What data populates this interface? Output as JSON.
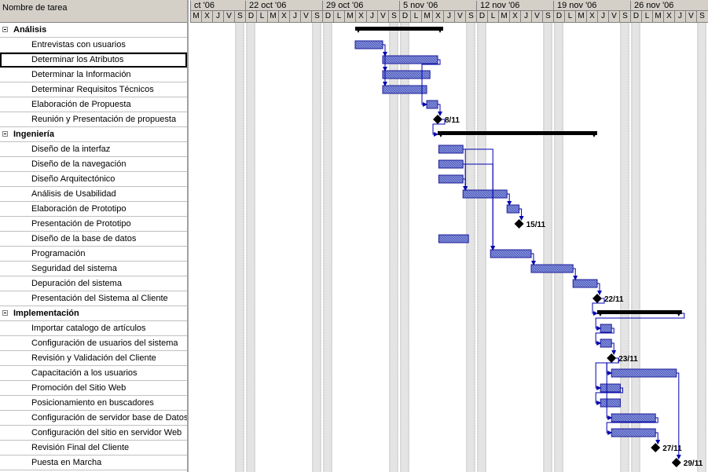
{
  "header": {
    "task_name_column": "Nombre de tarea"
  },
  "timescale": {
    "weeks": [
      {
        "label": "ct '06",
        "days": 5
      },
      {
        "label": "22 oct '06",
        "days": 7
      },
      {
        "label": "29 oct '06",
        "days": 7
      },
      {
        "label": "5 nov '06",
        "days": 7
      },
      {
        "label": "12 nov '06",
        "days": 7
      },
      {
        "label": "19 nov '06",
        "days": 7
      },
      {
        "label": "26 nov '06",
        "days": 7
      }
    ],
    "day_letters": [
      "M",
      "X",
      "J",
      "V",
      "S",
      "D",
      "L",
      "M",
      "X",
      "J",
      "V",
      "S",
      "D",
      "L",
      "M",
      "X",
      "J",
      "V",
      "S",
      "D",
      "L",
      "M",
      "X",
      "J",
      "V",
      "S",
      "D",
      "L",
      "M",
      "X",
      "J",
      "V",
      "S",
      "D",
      "L",
      "M",
      "X",
      "J",
      "V",
      "S",
      "D",
      "L",
      "M",
      "X",
      "J",
      "V",
      "S"
    ]
  },
  "tasks": [
    {
      "name": "Análisis",
      "type": "summary",
      "start": 15,
      "end": 23
    },
    {
      "name": "Entrevistas con usuarios",
      "type": "task",
      "start": 15,
      "end": 17.5
    },
    {
      "name": "Determinar los Atributos",
      "type": "task",
      "start": 17.5,
      "end": 22.5,
      "selected": true
    },
    {
      "name": "Determinar la Información",
      "type": "task",
      "start": 17.5,
      "end": 21.8
    },
    {
      "name": "Determinar Requisitos Técnicos",
      "type": "task",
      "start": 17.5,
      "end": 21.5
    },
    {
      "name": "Elaboración de Propuesta",
      "type": "task",
      "start": 21.5,
      "end": 22.5
    },
    {
      "name": "Reunión y Presentación de propuesta",
      "type": "milestone",
      "start": 22.5,
      "label": "8/11"
    },
    {
      "name": "Ingeniería",
      "type": "summary",
      "start": 22.5,
      "end": 37
    },
    {
      "name": "Diseño de la interfaz",
      "type": "task",
      "start": 22.6,
      "end": 24.8
    },
    {
      "name": "Diseño de la navegación",
      "type": "task",
      "start": 22.6,
      "end": 24.8
    },
    {
      "name": "Diseño Arquitectónico",
      "type": "task",
      "start": 22.6,
      "end": 24.8
    },
    {
      "name": "Análisis de Usabilidad",
      "type": "task",
      "start": 24.8,
      "end": 28.8
    },
    {
      "name": "Elaboración de Prototipo",
      "type": "task",
      "start": 28.8,
      "end": 29.9
    },
    {
      "name": "Presentación de Prototipo",
      "type": "milestone",
      "start": 29.9,
      "label": "15/11"
    },
    {
      "name": "Diseño de la base de datos",
      "type": "task",
      "start": 22.6,
      "end": 25.3
    },
    {
      "name": "Programación",
      "type": "task",
      "start": 27.3,
      "end": 31
    },
    {
      "name": "Seguridad del sistema",
      "type": "task",
      "start": 31,
      "end": 34.8
    },
    {
      "name": "Depuración del sistema",
      "type": "task",
      "start": 34.8,
      "end": 37
    },
    {
      "name": "Presentación del Sistema al Cliente",
      "type": "milestone",
      "start": 37,
      "label": "22/11"
    },
    {
      "name": "Implementación",
      "type": "summary",
      "start": 37,
      "end": 44.7
    },
    {
      "name": "Importar catalogo de artículos",
      "type": "task",
      "start": 37.3,
      "end": 38.3
    },
    {
      "name": "Configuración de usuarios del sistema",
      "type": "task",
      "start": 37.3,
      "end": 38.3
    },
    {
      "name": "Revisión y Validación del Cliente",
      "type": "milestone",
      "start": 38.3,
      "label": "23/11"
    },
    {
      "name": "Capacitación a los usuarios",
      "type": "task",
      "start": 38.3,
      "end": 44.2
    },
    {
      "name": "Promoción del Sitio Web",
      "type": "task",
      "start": 37.3,
      "end": 39.1
    },
    {
      "name": "Posicionamiento en buscadores",
      "type": "task",
      "start": 37.3,
      "end": 39.1
    },
    {
      "name": "Configuración de servidor base de Datos",
      "type": "task",
      "start": 38.3,
      "end": 42.3
    },
    {
      "name": "Configuración del sitio en servidor Web",
      "type": "task",
      "start": 38.3,
      "end": 42.3
    },
    {
      "name": "Revisión Final del Cliente",
      "type": "milestone",
      "start": 42.3,
      "label": "27/11"
    },
    {
      "name": "Puesta en Marcha",
      "type": "milestone",
      "start": 44.2,
      "label": "29/11"
    }
  ],
  "links": [
    [
      1,
      2
    ],
    [
      1,
      3
    ],
    [
      1,
      4
    ],
    [
      2,
      5
    ],
    [
      5,
      6
    ],
    [
      6,
      7
    ],
    [
      8,
      11
    ],
    [
      9,
      11
    ],
    [
      10,
      11
    ],
    [
      11,
      12
    ],
    [
      12,
      13
    ],
    [
      8,
      15
    ],
    [
      9,
      15
    ],
    [
      15,
      16
    ],
    [
      16,
      17
    ],
    [
      17,
      18
    ],
    [
      18,
      19
    ],
    [
      19,
      20
    ],
    [
      20,
      21
    ],
    [
      21,
      22
    ],
    [
      22,
      23
    ],
    [
      22,
      24
    ],
    [
      24,
      25
    ],
    [
      22,
      26
    ],
    [
      26,
      27
    ],
    [
      27,
      28
    ],
    [
      23,
      29
    ]
  ],
  "colors": {
    "bar_fill": "#6e7fd1",
    "bar_border": "#1c1c99",
    "summary": "#000000",
    "link": "#0000b0",
    "weekend_shade": "#e4e4e4"
  }
}
